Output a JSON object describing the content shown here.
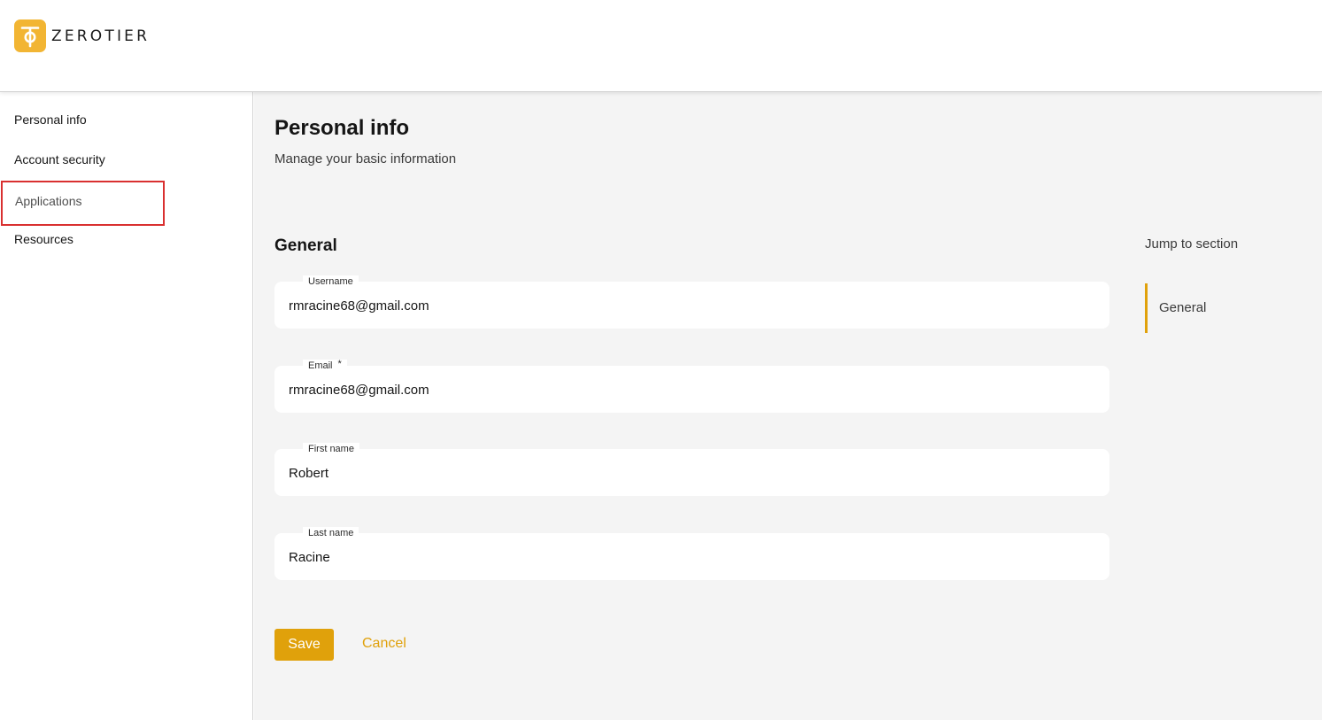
{
  "brand": {
    "name": "ZEROTIER",
    "accent_color": "#e0a10b",
    "logo_color": "#f2b533"
  },
  "sidebar": {
    "items": [
      {
        "label": "Personal info"
      },
      {
        "label": "Account security"
      },
      {
        "label": "Applications"
      },
      {
        "label": "Resources"
      }
    ]
  },
  "page": {
    "title": "Personal info",
    "subtitle": "Manage your basic information"
  },
  "section": {
    "title": "General"
  },
  "form": {
    "username": {
      "label": "Username",
      "value": "rmracine68@gmail.com"
    },
    "email": {
      "label": "Email",
      "required_mark": "*",
      "value": "rmracine68@gmail.com"
    },
    "first_name": {
      "label": "First name",
      "value": "Robert"
    },
    "last_name": {
      "label": "Last name",
      "value": "Racine"
    }
  },
  "actions": {
    "save_label": "Save",
    "cancel_label": "Cancel"
  },
  "jump": {
    "title": "Jump to section",
    "items": [
      {
        "label": "General"
      }
    ]
  }
}
